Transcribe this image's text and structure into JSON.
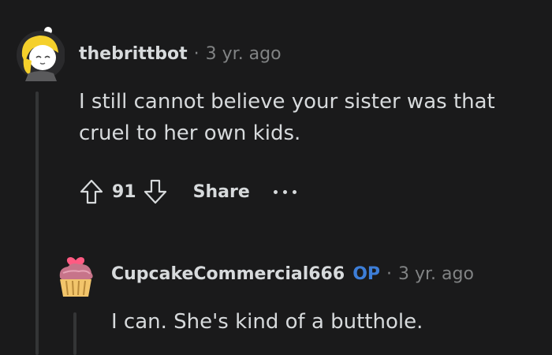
{
  "comment": {
    "author": "thebrittbot",
    "separator": "·",
    "time": "3 yr. ago",
    "text": "I still cannot believe your sister was that cruel to her own kids.",
    "score": "91",
    "share_label": "Share",
    "upvote_icon": "arrow-up-icon",
    "downvote_icon": "arrow-down-icon",
    "more_icon": "ellipsis-icon"
  },
  "reply": {
    "author": "CupcakeCommercial666",
    "op_badge": "OP",
    "separator": "·",
    "time": "3 yr. ago",
    "text": "I can. She's kind of a butthole."
  },
  "colors": {
    "background": "#1a1a1b",
    "text": "#d7dadc",
    "muted": "#818384",
    "op": "#3d7ed8",
    "thread_line": "#343536"
  }
}
